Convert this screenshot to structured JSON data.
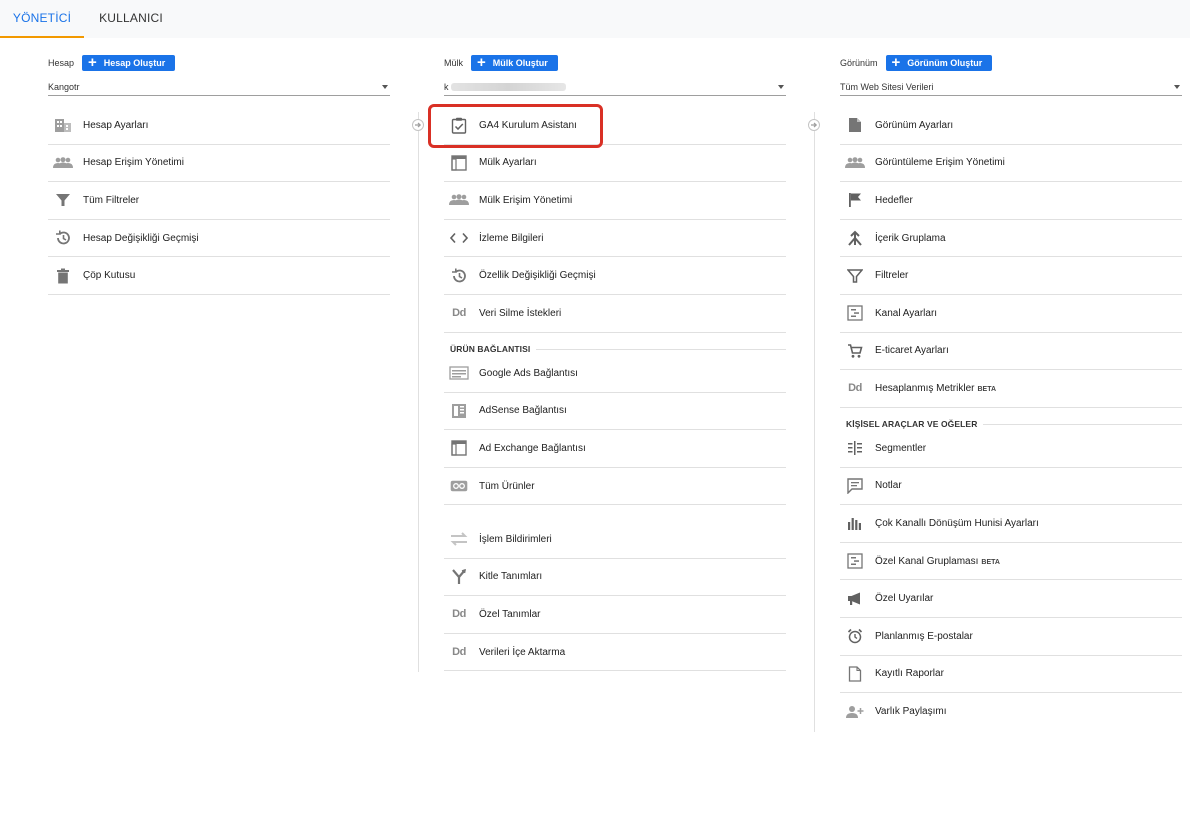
{
  "tabs": [
    {
      "label": "YÖNETİCİ",
      "active": true
    },
    {
      "label": "KULLANICI",
      "active": false
    }
  ],
  "account": {
    "label": "Hesap",
    "create_label": "Hesap Oluştur",
    "selected": "Kangotr",
    "items": [
      {
        "label": "Hesap Ayarları",
        "icon": "building-icon"
      },
      {
        "label": "Hesap Erişim Yönetimi",
        "icon": "people-icon"
      },
      {
        "label": "Tüm Filtreler",
        "icon": "filter-icon"
      },
      {
        "label": "Hesap Değişikliği Geçmişi",
        "icon": "history-icon"
      },
      {
        "label": "Çöp Kutusu",
        "icon": "trash-icon"
      }
    ]
  },
  "property": {
    "label": "Mülk",
    "create_label": "Mülk Oluştur",
    "selected": "k",
    "items": [
      {
        "label": "GA4 Kurulum Asistanı",
        "icon": "clipboard-check-icon"
      },
      {
        "label": "Mülk Ayarları",
        "icon": "window-icon"
      },
      {
        "label": "Mülk Erişim Yönetimi",
        "icon": "people-icon"
      },
      {
        "label": "İzleme Bilgileri",
        "icon": "code-icon"
      },
      {
        "label": "Özellik Değişikliği Geçmişi",
        "icon": "history-icon"
      },
      {
        "label": "Veri Silme İstekleri",
        "icon": "dd-icon"
      }
    ],
    "links_title": "ÜRÜN BAĞLANTISI",
    "links": [
      {
        "label": "Google Ads Bağlantısı",
        "icon": "ads-icon"
      },
      {
        "label": "AdSense Bağlantısı",
        "icon": "adsense-icon"
      },
      {
        "label": "Ad Exchange Bağlantısı",
        "icon": "window-icon"
      },
      {
        "label": "Tüm Ürünler",
        "icon": "link-icon"
      }
    ],
    "other": [
      {
        "label": "İşlem Bildirimleri",
        "icon": "swap-icon"
      },
      {
        "label": "Kitle Tanımları",
        "icon": "fork-icon"
      },
      {
        "label": "Özel Tanımlar",
        "icon": "dd-icon"
      },
      {
        "label": "Verileri İçe Aktarma",
        "icon": "dd-icon"
      }
    ]
  },
  "view": {
    "label": "Görünüm",
    "create_label": "Görünüm Oluştur",
    "selected": "Tüm Web Sitesi Verileri",
    "items": [
      {
        "label": "Görünüm Ayarları",
        "icon": "document-icon"
      },
      {
        "label": "Görüntüleme Erişim Yönetimi",
        "icon": "people-icon"
      },
      {
        "label": "Hedefler",
        "icon": "flag-icon"
      },
      {
        "label": "İçerik Gruplama",
        "icon": "merge-icon"
      },
      {
        "label": "Filtreler",
        "icon": "filter-icon"
      },
      {
        "label": "Kanal Ayarları",
        "icon": "channel-icon"
      },
      {
        "label": "E-ticaret Ayarları",
        "icon": "cart-icon"
      },
      {
        "label": "Hesaplanmış Metrikler",
        "icon": "dd-icon",
        "badge": "BETA"
      }
    ],
    "tools_title": "KİŞİSEL ARAÇLAR VE OĞELER",
    "tools": [
      {
        "label": "Segmentler",
        "icon": "segments-icon"
      },
      {
        "label": "Notlar",
        "icon": "note-icon"
      },
      {
        "label": "Çok Kanallı Dönüşüm Hunisi Ayarları",
        "icon": "bar-chart-icon"
      },
      {
        "label": "Özel Kanal Gruplaması",
        "icon": "channel-icon",
        "badge": "BETA"
      },
      {
        "label": "Özel Uyarılar",
        "icon": "megaphone-icon"
      },
      {
        "label": "Planlanmış E-postalar",
        "icon": "alarm-icon"
      },
      {
        "label": "Kayıtlı Raporlar",
        "icon": "file-icon"
      },
      {
        "label": "Varlık Paylaşımı",
        "icon": "person-add-icon"
      }
    ]
  }
}
